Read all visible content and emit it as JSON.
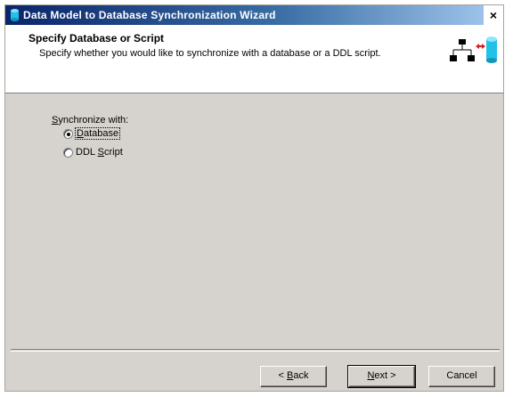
{
  "window": {
    "title": "Data Model to Database Synchronization Wizard",
    "close_glyph": "×"
  },
  "header": {
    "title": "Specify Database or Script",
    "subtitle": "Specify whether you would like to synchronize with a database or a DDL script.",
    "icon": "model-to-database-sync-icon"
  },
  "sync": {
    "label_pre": "",
    "label_mnemonic": "S",
    "label_post": "ynchronize with:",
    "options": [
      {
        "mnemonic": "D",
        "rest": "atabase",
        "selected": true
      },
      {
        "pre": "DDL ",
        "mnemonic": "S",
        "rest": "cript",
        "selected": false
      }
    ]
  },
  "buttons": {
    "back": {
      "pre": "< ",
      "mnemonic": "B",
      "rest": "ack"
    },
    "next": {
      "mnemonic": "N",
      "rest": "ext >"
    },
    "cancel": "Cancel"
  },
  "colors": {
    "dialog_bg": "#d6d3ce",
    "title_gradient_start": "#0a246a",
    "title_gradient_end": "#a6caf0",
    "db_icon": "#22c1e8",
    "sync_arrow": "#d02020"
  }
}
